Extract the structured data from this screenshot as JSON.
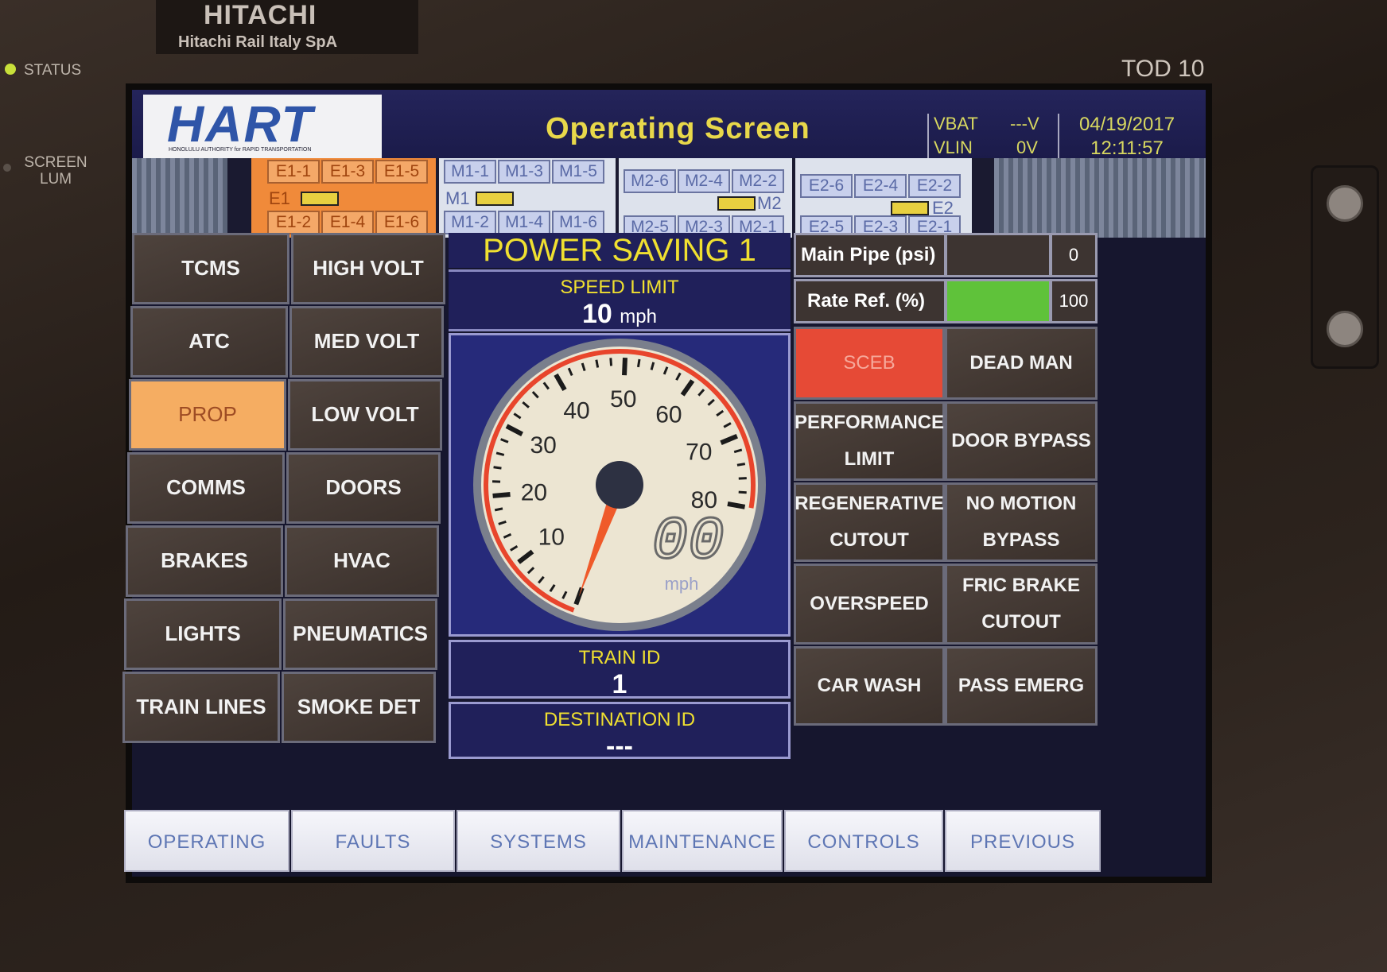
{
  "device": {
    "brand": "HITACHI",
    "brand_sub": "Hitachi Rail Italy SpA",
    "status_label": "STATUS",
    "screen_lum_label": "SCREEN\nLUM",
    "unit_label": "TOD 10"
  },
  "header": {
    "logo_text": "HART",
    "logo_subtext": "HONOLULU AUTHORITY for RAPID TRANSPORTATION",
    "title": "Operating Screen",
    "vbat_label": "VBAT",
    "vbat_value": "---V",
    "vlin_label": "VLIN",
    "vlin_value": "0V",
    "date": "04/19/2017",
    "time": "12:11:57"
  },
  "train": {
    "cars": [
      {
        "label": "E1",
        "active": true,
        "doors_top": [
          "E1-1",
          "E1-3",
          "E1-5"
        ],
        "doors_bottom": [
          "E1-2",
          "E1-4",
          "E1-6"
        ]
      },
      {
        "label": "M1",
        "active": false,
        "doors_top": [
          "M1-1",
          "M1-3",
          "M1-5"
        ],
        "doors_bottom": [
          "M1-2",
          "M1-4",
          "M1-6"
        ]
      },
      {
        "label": "M2",
        "active": false,
        "doors_top": [
          "M2-6",
          "M2-4",
          "M2-2"
        ],
        "doors_bottom": [
          "M2-5",
          "M2-3",
          "M2-1"
        ]
      },
      {
        "label": "E2",
        "active": false,
        "doors_top": [
          "E2-6",
          "E2-4",
          "E2-2"
        ],
        "doors_bottom": [
          "E2-5",
          "E2-3",
          "E2-1"
        ]
      }
    ]
  },
  "systems_menu": [
    "TCMS",
    "HIGH VOLT",
    "ATC",
    "MED VOLT",
    "PROP",
    "LOW VOLT",
    "COMMS",
    "DOORS",
    "BRAKES",
    "HVAC",
    "LIGHTS",
    "PNEUMATICS",
    "TRAIN LINES",
    "SMOKE DET"
  ],
  "selected_system": "PROP",
  "mode": {
    "power_saving": "POWER SAVING 1",
    "speed_limit_label": "SPEED LIMIT",
    "speed_limit_value": "10",
    "speed_limit_unit": "mph"
  },
  "gauge": {
    "ticks": [
      "10",
      "20",
      "30",
      "40",
      "50",
      "60",
      "70",
      "80"
    ],
    "digital_speed": "00",
    "unit": "mph",
    "speed_value": 0,
    "max_speed": 80
  },
  "train_id": {
    "label": "TRAIN ID",
    "value": "1"
  },
  "destination": {
    "label": "DESTINATION ID",
    "value": "---"
  },
  "pressure": {
    "main_pipe_label": "Main Pipe (psi)",
    "main_pipe_value": "0",
    "rate_ref_label": "Rate Ref. (%)",
    "rate_ref_value": "100",
    "rate_ref_fraction": 1.0,
    "rate_ref_color": "#5fc23a"
  },
  "status_buttons": [
    [
      "SCEB",
      "DEAD MAN"
    ],
    [
      "PERFORMANCE\nLIMIT",
      "DOOR BYPASS"
    ],
    [
      "REGENERATIVE\nCUTOUT",
      "NO MOTION\nBYPASS"
    ],
    [
      "OVERSPEED",
      "FRIC BRAKE\nCUTOUT"
    ],
    [
      "CAR WASH",
      "PASS EMERG"
    ]
  ],
  "tabs": [
    "OPERATING",
    "FAULTS",
    "SYSTEMS",
    "MAINTENANCE",
    "CONTROLS",
    "PREVIOUS"
  ],
  "colors": {
    "accent_yellow": "#f0e030",
    "prop_orange": "#f5ad62",
    "sceb_red": "#e64a36"
  }
}
